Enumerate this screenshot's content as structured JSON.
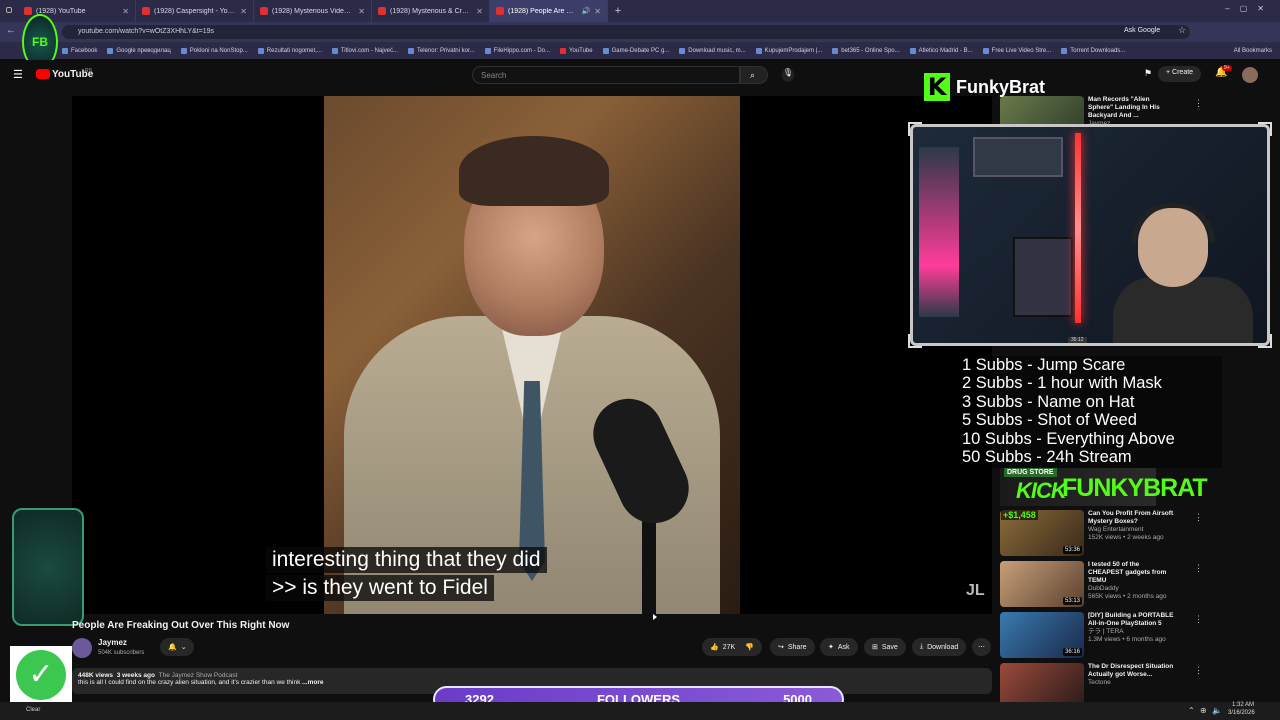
{
  "browser": {
    "tabs": [
      {
        "label": "(1928) YouTube",
        "active": false
      },
      {
        "label": "(1928) Caspersight - YouTube",
        "active": false
      },
      {
        "label": "(1928) Mysterious Videos That",
        "active": false
      },
      {
        "label": "(1928) Mysterious & Creepy Ti",
        "active": false
      },
      {
        "label": "(1928) People Are Freaking",
        "active": true
      }
    ],
    "url": "youtube.com/watch?v=wOtZ3XHhLY&t=19s",
    "ask_google": "Ask Google",
    "bookmarks": [
      "Facebook",
      "Google преводилац",
      "Pokloni na NonStop...",
      "Rezultati nogomet,...",
      "Titlovi.com - Najveć...",
      "Telenor: Privatni kor...",
      "FileHippo.com - Do...",
      "YouTube",
      "Game-Debate PC g...",
      "Download music, m...",
      "KupujemProdajem |...",
      "bet365 - Online Spo...",
      "Atletico Madrid - B...",
      "Free Live Video Stre...",
      "Torrent Downloads..."
    ],
    "all_bookmarks": "All Bookmarks"
  },
  "youtube": {
    "logo": "YouTube",
    "logo_sup": "RS",
    "search_placeholder": "Search",
    "create": "Create",
    "notif_count": "9+"
  },
  "video": {
    "subtitle_line1": "interesting thing that they did",
    "subtitle_line2": ">> is they went to Fidel",
    "watermark": "JL",
    "title": "People Are Freaking Out Over This Right Now",
    "channel": "Jaymez",
    "subscribers": "504K subscribers",
    "likes": "27K",
    "share": "Share",
    "ask": "Ask",
    "save": "Save",
    "download": "Download",
    "views": "448K views",
    "age": "3 weeks ago",
    "podcast": "The Jaymez Show Podcast",
    "description": "this is all I could find on the crazy alien situation, and it's crazier than we think",
    "more": "...more"
  },
  "recommendations": [
    {
      "title": "Man Records \"Alien Sphere\" Landing In His Backyard And ...",
      "channel": "Jaymez",
      "meta": "",
      "duration": ""
    },
    {
      "title": "Can You Profit From Airsoft Mystery Boxes?",
      "channel": "Wag Entertainment",
      "meta": "152K views • 2 weeks ago",
      "duration": "53:36"
    },
    {
      "title": "I tested 50 of the CHEAPEST gadgets from TEMU",
      "channel": "DubDaddy",
      "meta": "565K views • 2 months ago",
      "duration": "53:13"
    },
    {
      "title": "[DIY] Building a PORTABLE All-in-One PlayStation 5",
      "channel": "テラ | TERA",
      "meta": "1.3M views • 6 months ago",
      "duration": "36:16"
    },
    {
      "title": "The Dr Disrespect Situation Actually got Worse...",
      "channel": "Tectone",
      "meta": "",
      "duration": ""
    }
  ],
  "overlay": {
    "streamer": "FunkyBrat",
    "kick_letter": "K",
    "goals": [
      "1 Subbs - Jump Scare",
      "2 Subbs - 1 hour with Mask",
      "3 Subbs - Name on Hat",
      "5 Subbs - Shot of Weed",
      "10 Subbs - Everything Above",
      "50 Subbs - 24h Stream"
    ],
    "kick_banner_prefix": "KICK",
    "kick_banner_name": "FUNKYBRAT",
    "drug_store": "DRUG STORE",
    "price": "+$1,458",
    "followers_current": "3292",
    "followers_label": "FOLLOWERS",
    "followers_goal": "5000",
    "cam_timer": "35:12"
  },
  "taskbar": {
    "time": "1:32 AM",
    "date": "3/16/2026",
    "clear": "Clear"
  }
}
